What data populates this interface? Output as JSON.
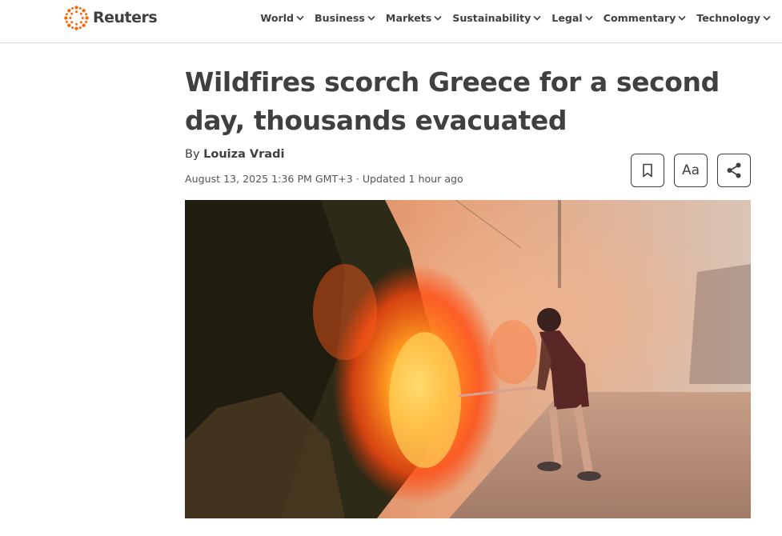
{
  "brand": {
    "name": "Reuters",
    "logo_icon": "reuters-dot-ring-logo",
    "accent_color": "#fa6400"
  },
  "nav": {
    "items": [
      {
        "label": "World"
      },
      {
        "label": "Business"
      },
      {
        "label": "Markets"
      },
      {
        "label": "Sustainability"
      },
      {
        "label": "Legal"
      },
      {
        "label": "Commentary"
      },
      {
        "label": "Technology"
      }
    ],
    "dropdown_icon": "chevron-down-icon"
  },
  "article": {
    "headline": "Wildfires scorch Greece for a second day, thousands evacuated",
    "byline_prefix": "By",
    "author": "Louiza Vradi",
    "date": "August 13, 2025 1:36 PM GMT+3",
    "separator": "·",
    "updated": "Updated 1 hour ago"
  },
  "tools": {
    "bookmark_icon": "bookmark-icon",
    "text_size_label": "Aa",
    "share_icon": "share-icon"
  },
  "colors": {
    "text": "#404040",
    "divider": "#d9d9d9"
  }
}
